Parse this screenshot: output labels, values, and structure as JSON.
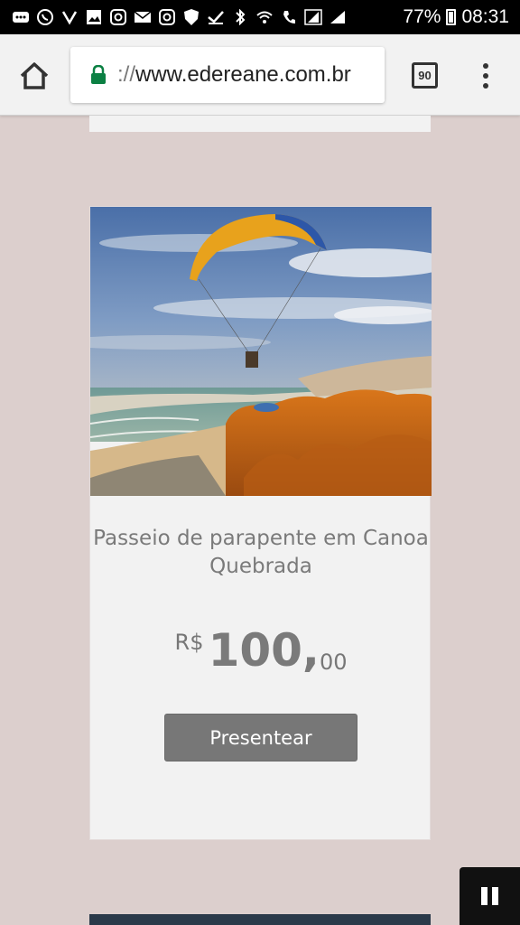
{
  "status_bar": {
    "battery": "77%",
    "time": "08:31",
    "icons": [
      "message-icon",
      "whatsapp-icon",
      "vivo-icon",
      "image-icon",
      "instagram-icon",
      "mail-icon",
      "instagram-icon",
      "shield-icon",
      "check-icon",
      "bluetooth-vibrate-icon",
      "wifi-icon",
      "phone-icon",
      "signal-icon",
      "signal-icon",
      "battery-icon"
    ]
  },
  "browser": {
    "url_scheme": "://",
    "url_host": "www.edereane.com.br",
    "tab_count": "90"
  },
  "product": {
    "title": "Passeio de parapente em Canoa Quebrada",
    "currency": "R$",
    "price_integer": "100,",
    "price_cents": "00",
    "button_label": "Presentear",
    "image": "paraglider-over-cliffs-photo"
  },
  "colors": {
    "page_bg": "#dccfcd",
    "card_bg": "#f2f2f2",
    "button_bg": "#777777",
    "lock_green": "#0b8043"
  }
}
